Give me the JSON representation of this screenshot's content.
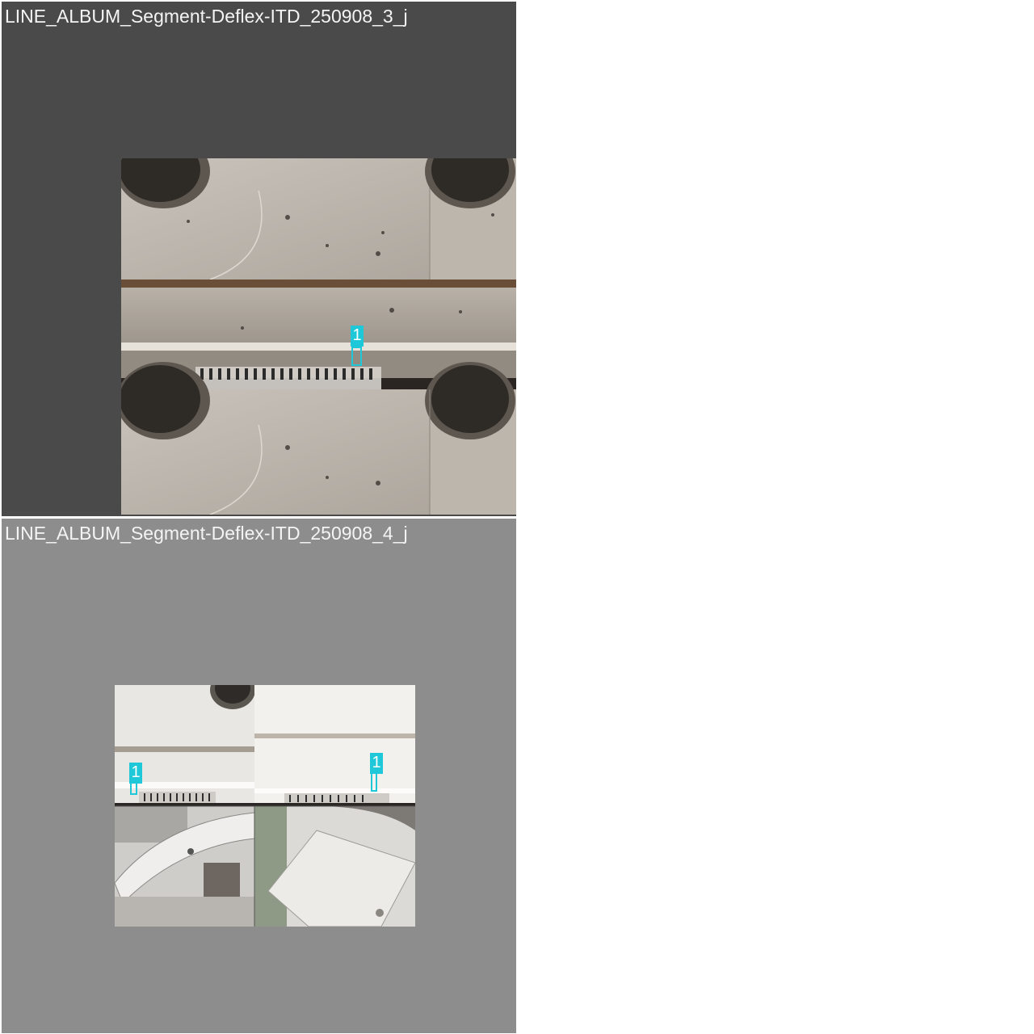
{
  "tiles": [
    {
      "title": "LINE_ALBUM_Segment-Deflex-ITD_250908_3_j",
      "detections": [
        {
          "label": "1"
        }
      ]
    },
    {
      "title": "LINE_ALBUM_Segment-Deflex-ITD_250908_4_j",
      "detections": [
        {
          "label": "1"
        },
        {
          "label": "1"
        }
      ]
    }
  ],
  "colors": {
    "tile_1_bg": "#4a4a4a",
    "tile_2_bg": "#8d8d8d",
    "detection": "#1ec8d8"
  }
}
